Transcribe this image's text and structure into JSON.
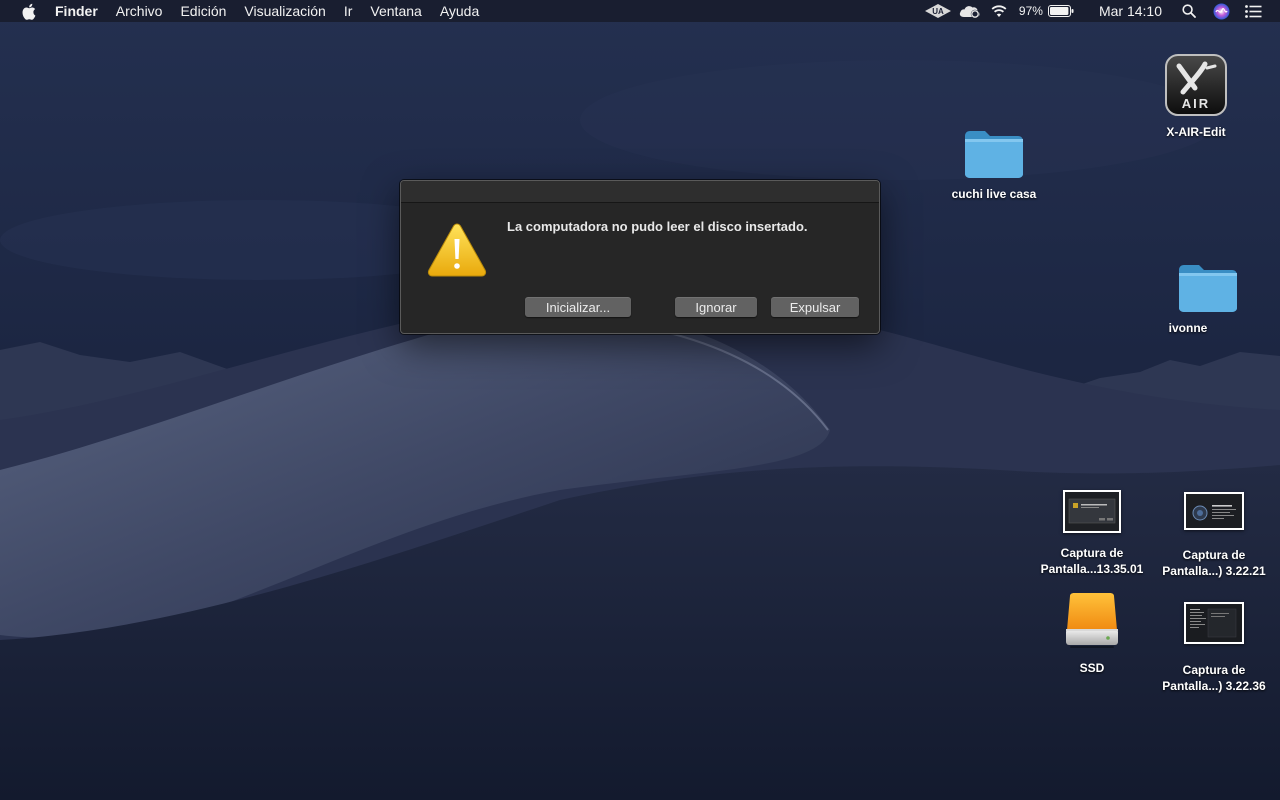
{
  "menubar": {
    "apple_icon": "apple-logo-icon",
    "app_name": "Finder",
    "menus": [
      "Archivo",
      "Edición",
      "Visualización",
      "Ir",
      "Ventana",
      "Ayuda"
    ],
    "status": {
      "icons": [
        "universal-audio-icon",
        "creative-cloud-icon",
        "wifi-icon",
        "battery-icon",
        "search-icon",
        "siri-icon",
        "notification-center-icon"
      ],
      "battery_percent": "97%",
      "battery_level": 0.97,
      "clock": "Mar 14:10"
    }
  },
  "desktop": {
    "icons": [
      {
        "id": "xair",
        "label": "X-AIR-Edit",
        "icon": "x-air-app-icon"
      },
      {
        "id": "cuchi",
        "label": "cuchi live casa",
        "icon": "folder-icon"
      },
      {
        "id": "ivonne",
        "label": "ivonne",
        "icon": "folder-icon"
      },
      {
        "id": "cap1",
        "label_line1": "Captura de",
        "label_line2": "Pantalla...13.35.01",
        "icon": "screenshot-thumbnail-icon"
      },
      {
        "id": "cap2",
        "label_line1": "Captura de",
        "label_line2": "Pantalla...) 3.22.21",
        "icon": "screenshot-thumbnail-icon"
      },
      {
        "id": "ssd",
        "label": "SSD",
        "icon": "external-drive-icon"
      },
      {
        "id": "cap3",
        "label_line1": "Captura de",
        "label_line2": "Pantalla...) 3.22.36",
        "icon": "screenshot-thumbnail-icon"
      }
    ]
  },
  "dialog": {
    "icon": "warning-icon",
    "message": "La computadora no pudo leer el disco insertado.",
    "buttons": {
      "initialize": "Inicializar...",
      "ignore": "Ignorar",
      "eject": "Expulsar"
    }
  },
  "colors": {
    "sky_top": "#1f2a45",
    "dune": "#4a5470",
    "dialog_bg": "#262626",
    "button_bg": "#626262",
    "warning_yellow": "#f5c518",
    "folder_blue": "#4aa3d8",
    "drive_orange": "#f5a623"
  }
}
